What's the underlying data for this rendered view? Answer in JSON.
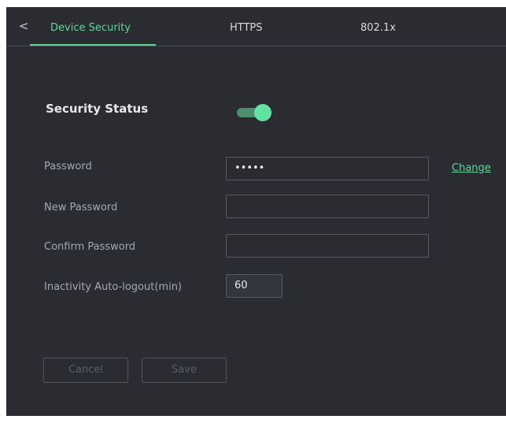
{
  "tabs": {
    "back_icon": "chevron-left-icon",
    "back_glyph": "<",
    "items": [
      {
        "label": "Device Security",
        "active": true
      },
      {
        "label": "HTTPS",
        "active": false
      },
      {
        "label": "802.1x",
        "active": false
      }
    ]
  },
  "security": {
    "title": "Security Status",
    "toggle_on": true
  },
  "form": {
    "password_label": "Password",
    "password_value": "•••••",
    "change_link": "Change",
    "new_password_label": "New Password",
    "new_password_value": "",
    "confirm_password_label": "Confirm Password",
    "confirm_password_value": "",
    "inactivity_label": "Inactivity Auto-logout(min)",
    "inactivity_value": "60"
  },
  "buttons": {
    "cancel_label": "Cancel",
    "save_label": "Save"
  },
  "colors": {
    "accent": "#5fd79a",
    "panel_background": "#2a2c32",
    "toggle_track": "#4b8f6b"
  }
}
